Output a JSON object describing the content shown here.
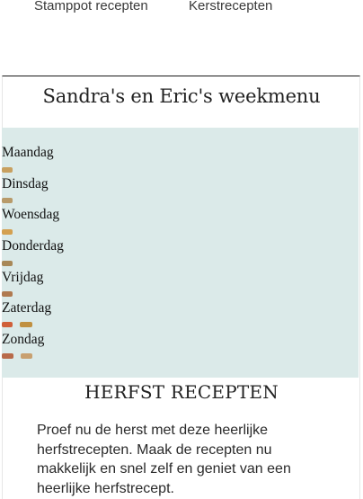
{
  "top_links": [
    "Stamppot recepten",
    "Kerstrecepten"
  ],
  "weekmenu": {
    "title": "Sandra's en Eric's weekmenu",
    "days": [
      {
        "label": "Maandag",
        "thumbs": [
          "#c8a060"
        ]
      },
      {
        "label": "Dinsdag",
        "thumbs": [
          "#b89a6a"
        ]
      },
      {
        "label": "Woensdag",
        "thumbs": [
          "#d4a050"
        ]
      },
      {
        "label": "Donderdag",
        "thumbs": [
          "#a88858"
        ]
      },
      {
        "label": "Vrijdag",
        "thumbs": [
          "#b07a50"
        ]
      },
      {
        "label": "Zaterdag",
        "thumbs": [
          "#d0603a",
          "#c09040"
        ]
      },
      {
        "label": "Zondag",
        "thumbs": [
          "#b86a4a",
          "#c8a070"
        ]
      }
    ],
    "panel_color": "#dbeae9"
  },
  "herfst": {
    "title": "HERFST RECEPTEN",
    "text": "Proef nu de herst met deze heerlijke herfstrecepten. Maak de recepten nu makkelijk en snel zelf en geniet van een heerlijke herfstrecept."
  }
}
